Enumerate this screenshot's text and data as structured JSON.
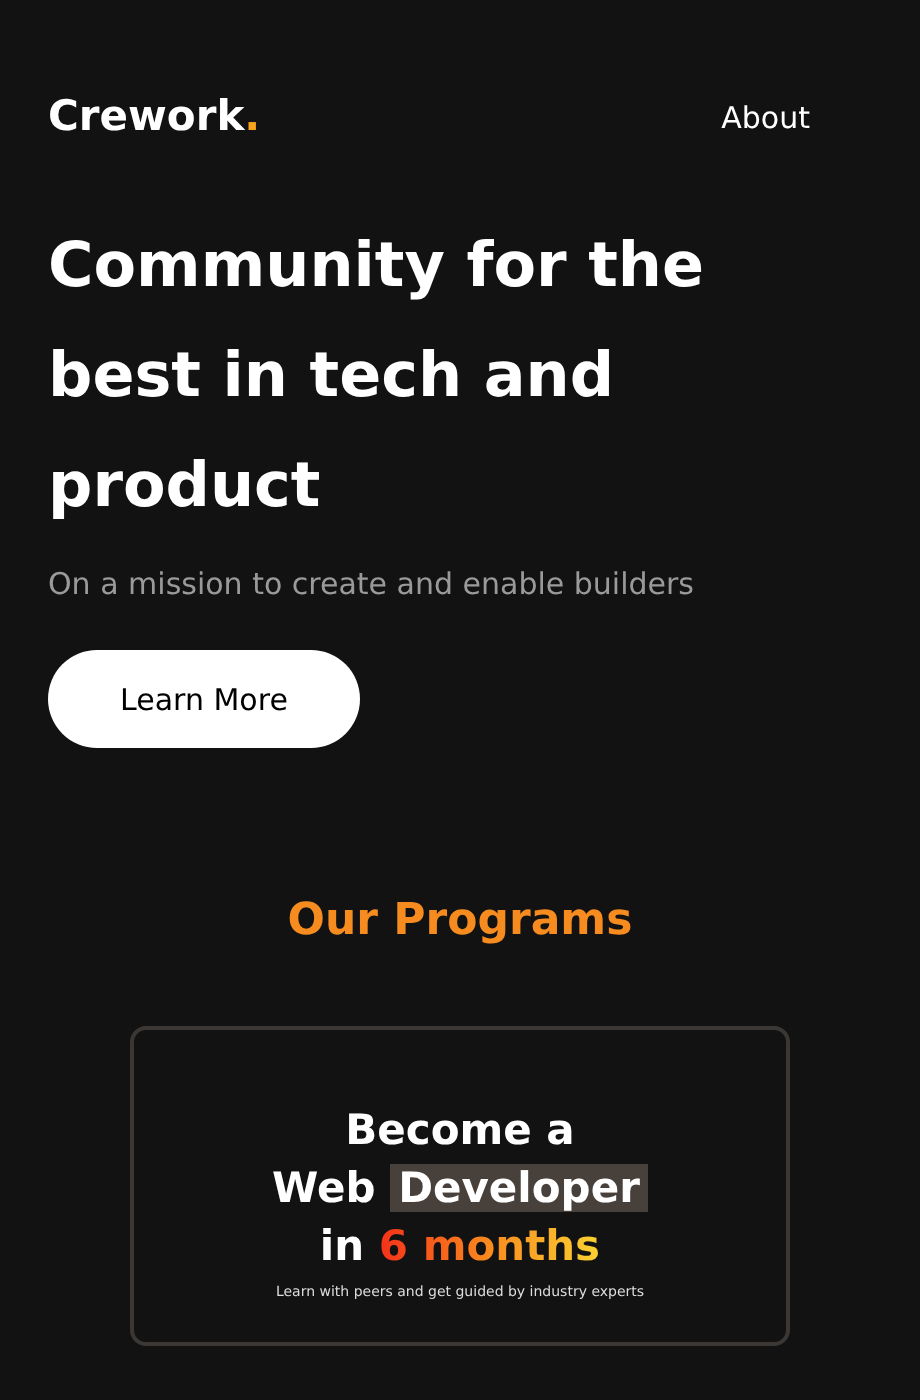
{
  "brand": {
    "name": "Crework",
    "dot": "."
  },
  "nav": [
    {
      "label": "About"
    }
  ],
  "hero": {
    "title": "Community for the best in tech and product",
    "subtitle": "On a mission to create and enable builders",
    "button": "Learn More"
  },
  "programs": {
    "heading": "Our Programs",
    "card": {
      "title_lines": [
        [
          {
            "kind": "plain",
            "text": "Become a"
          }
        ],
        [
          {
            "kind": "plain",
            "text": "Web "
          },
          {
            "kind": "highlight",
            "text": "Developer"
          }
        ],
        [
          {
            "kind": "plain",
            "text": "in "
          },
          {
            "kind": "gradient",
            "text": "6 months"
          }
        ]
      ],
      "subtitle": "Learn with peers and get guided by industry experts"
    }
  }
}
